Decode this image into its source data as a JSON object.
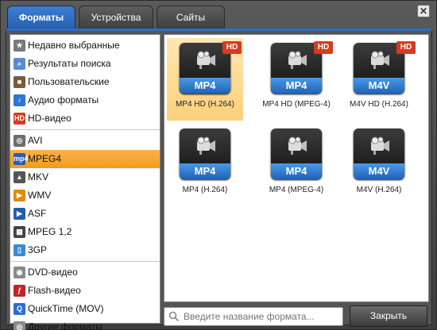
{
  "tabs": [
    {
      "label": "Форматы",
      "active": true
    },
    {
      "label": "Устройства",
      "active": false
    },
    {
      "label": "Сайты",
      "active": false
    }
  ],
  "close_symbol": "✕",
  "sidebar": {
    "groups": [
      [
        {
          "label": "Недавно выбранные",
          "icon": "recent-icon",
          "color": "#7a7a7a",
          "glyph": "★"
        },
        {
          "label": "Результаты поиска",
          "icon": "search-results-icon",
          "color": "#5a8ad6",
          "glyph": "⌕"
        },
        {
          "label": "Пользовательские",
          "icon": "user-icon",
          "color": "#7a5a3a",
          "glyph": "☻"
        },
        {
          "label": "Аудио форматы",
          "icon": "music-note-icon",
          "color": "#2b76d6",
          "glyph": "♪"
        },
        {
          "label": "HD-видео",
          "icon": "hd-icon",
          "color": "#d83a1f",
          "glyph": "HD"
        }
      ],
      [
        {
          "label": "AVI",
          "icon": "avi-icon",
          "color": "#6c6c6c",
          "glyph": "◎"
        },
        {
          "label": "MPEG4",
          "icon": "mp4-icon",
          "color": "#2c5fb0",
          "glyph": "mp4",
          "selected": true
        },
        {
          "label": "MKV",
          "icon": "mkv-icon",
          "color": "#555",
          "glyph": "▲"
        },
        {
          "label": "WMV",
          "icon": "wmv-icon",
          "color": "#e08a10",
          "glyph": "▶"
        },
        {
          "label": "ASF",
          "icon": "asf-icon",
          "color": "#1f5fb0",
          "glyph": "▶"
        },
        {
          "label": "MPEG 1,2",
          "icon": "mpeg-icon",
          "color": "#444",
          "glyph": "▦"
        },
        {
          "label": "3GP",
          "icon": "3gp-icon",
          "color": "#3a8ad6",
          "glyph": "▯"
        }
      ],
      [
        {
          "label": "DVD-видео",
          "icon": "dvd-icon",
          "color": "#8a8a8a",
          "glyph": "◉"
        },
        {
          "label": "Flash-видео",
          "icon": "flash-icon",
          "color": "#c8202a",
          "glyph": "ƒ"
        },
        {
          "label": "QuickTime (MOV)",
          "icon": "quicktime-icon",
          "color": "#2a6fd6",
          "glyph": "Q"
        },
        {
          "label": "Другие форматы",
          "icon": "other-formats-icon",
          "color": "#8a8a8a",
          "glyph": "◎"
        }
      ]
    ]
  },
  "formats": [
    {
      "badge": "MP4",
      "label": "MP4 HD (H.264)",
      "hd": true,
      "selected": true
    },
    {
      "badge": "MP4",
      "label": "MP4 HD (MPEG-4)",
      "hd": true,
      "selected": false
    },
    {
      "badge": "M4V",
      "label": "M4V HD (H.264)",
      "hd": true,
      "selected": false
    },
    {
      "badge": "MP4",
      "label": "MP4 (H.264)",
      "hd": false,
      "selected": false
    },
    {
      "badge": "MP4",
      "label": "MP4 (MPEG-4)",
      "hd": false,
      "selected": false
    },
    {
      "badge": "M4V",
      "label": "M4V (H.264)",
      "hd": false,
      "selected": false
    }
  ],
  "hd_label": "HD",
  "search": {
    "placeholder": "Введите название формата..."
  },
  "close_button": "Закрыть",
  "colors": {
    "accent": "#2f6cc4",
    "selected": "#f39a1e",
    "hd": "#d83a1f"
  }
}
